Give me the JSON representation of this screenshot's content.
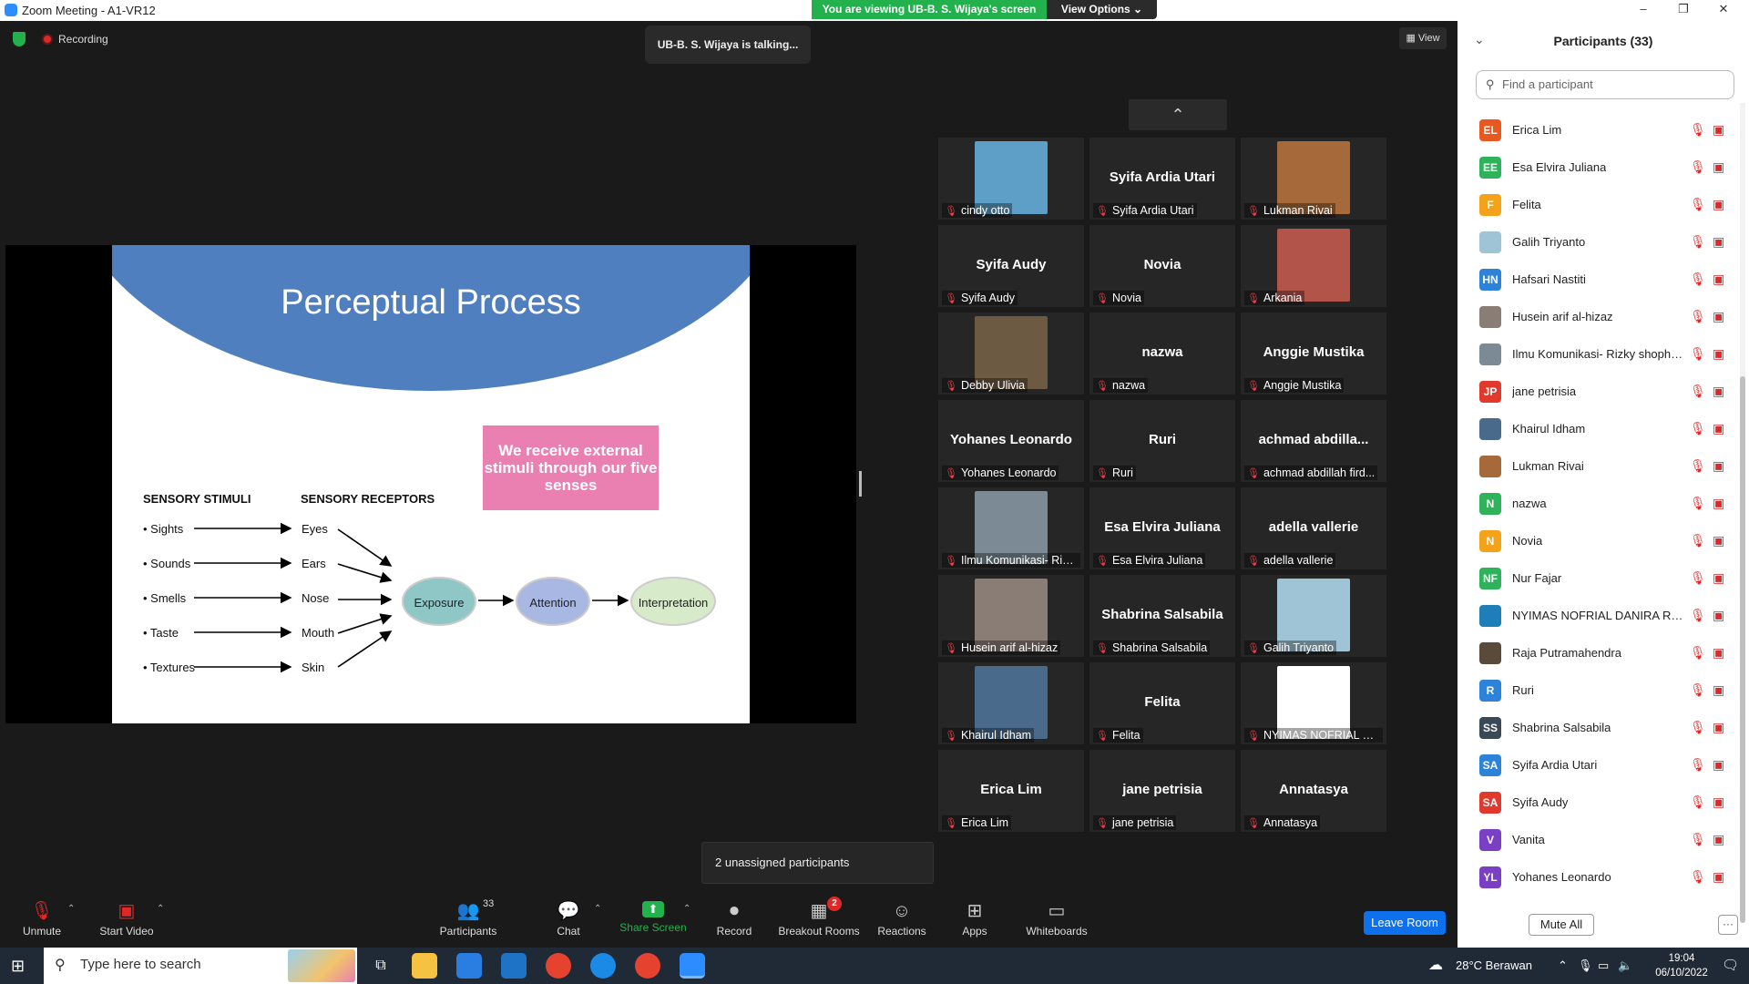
{
  "window": {
    "title": "Zoom Meeting - A1-VR12",
    "viewing_banner": "You are viewing UB-B. S. Wijaya's screen",
    "view_options_label": "View Options ⌄",
    "minimize": "–",
    "restore": "❐",
    "close": "✕"
  },
  "meeting": {
    "recording_label": "Recording",
    "talking_indicator": "UB-B. S. Wijaya is talking...",
    "view_button_label": "View",
    "unassigned_label": "2 unassigned participants"
  },
  "slide": {
    "title": "Perceptual Process",
    "callout": "We receive external stimuli through our five senses",
    "stimuli_header": "SENSORY STIMULI",
    "receptors_header": "SENSORY RECEPTORS",
    "stimuli": [
      "• Sights",
      "• Sounds",
      "• Smells",
      "• Taste",
      "• Textures"
    ],
    "receptors": [
      "Eyes",
      "Ears",
      "Nose",
      "Mouth",
      "Skin"
    ],
    "stages": [
      "Exposure",
      "Attention",
      "Interpretation"
    ]
  },
  "gallery": {
    "up_arrow": "⌃",
    "tiles": [
      {
        "label": "cindy otto",
        "big": "",
        "photo": "#5d9fc7"
      },
      {
        "label": "Syifa Ardia Utari",
        "big": "Syifa Ardia Utari",
        "photo": ""
      },
      {
        "label": "Lukman Rivai",
        "big": "",
        "photo": "#a66a3a"
      },
      {
        "label": "Syifa Audy",
        "big": "Syifa Audy",
        "photo": ""
      },
      {
        "label": "Novia",
        "big": "Novia",
        "photo": ""
      },
      {
        "label": "Arkania",
        "big": "",
        "photo": "#b2544a"
      },
      {
        "label": "Debby Ulivia",
        "big": "",
        "photo": "#6d5a43"
      },
      {
        "label": "nazwa",
        "big": "nazwa",
        "photo": ""
      },
      {
        "label": "Anggie Mustika",
        "big": "Anggie Mustika",
        "photo": ""
      },
      {
        "label": "Yohanes Leonardo",
        "big": "Yohanes Leonardo",
        "photo": ""
      },
      {
        "label": "Ruri",
        "big": "Ruri",
        "photo": ""
      },
      {
        "label": "achmad abdillah fird...",
        "big": "achmad  abdilla...",
        "photo": ""
      },
      {
        "label": "Ilmu Komunikasi- Rizk...",
        "big": "",
        "photo": "#7b8a95"
      },
      {
        "label": "Esa Elvira Juliana",
        "big": "Esa Elvira Juliana",
        "photo": ""
      },
      {
        "label": "adella vallerie",
        "big": "adella vallerie",
        "photo": ""
      },
      {
        "label": "Husein arif al-hizaz",
        "big": "",
        "photo": "#8a7d76"
      },
      {
        "label": "Shabrina Salsabila",
        "big": "Shabrina Salsabila",
        "photo": ""
      },
      {
        "label": "Galih Triyanto",
        "big": "",
        "photo": "#9fc4d6"
      },
      {
        "label": "Khairul Idham",
        "big": "",
        "photo": "#4a6a8c"
      },
      {
        "label": "Felita",
        "big": "Felita",
        "photo": ""
      },
      {
        "label": "NYIMAS NOFRIAL DA...",
        "big": "",
        "photo": "#ffffff"
      },
      {
        "label": "Erica Lim",
        "big": "Erica Lim",
        "photo": ""
      },
      {
        "label": "jane petrisia",
        "big": "jane petrisia",
        "photo": ""
      },
      {
        "label": "Annatasya",
        "big": "Annatasya",
        "photo": ""
      }
    ]
  },
  "toolbar": {
    "unmute": "Unmute",
    "start_video": "Start Video",
    "participants": "Participants",
    "participants_count": "33",
    "chat": "Chat",
    "share_screen": "Share Screen",
    "record": "Record",
    "breakout_rooms": "Breakout Rooms",
    "breakout_badge": "2",
    "reactions": "Reactions",
    "apps": "Apps",
    "whiteboards": "Whiteboards",
    "leave_room": "Leave Room"
  },
  "panel": {
    "title": "Participants (33)",
    "search_placeholder": "Find a participant",
    "mute_all": "Mute All",
    "more": "···",
    "participants": [
      {
        "initials": "EL",
        "name": "Erica Lim",
        "color": "#e8581f"
      },
      {
        "initials": "EE",
        "name": "Esa Elvira Juliana",
        "color": "#2fb35a"
      },
      {
        "initials": "F",
        "name": "Felita",
        "color": "#f5a21b"
      },
      {
        "initials": "",
        "name": "Galih Triyanto",
        "color": "#9fc4d6"
      },
      {
        "initials": "HN",
        "name": "Hafsari Nastiti",
        "color": "#2d82d9"
      },
      {
        "initials": "",
        "name": "Husein arif al-hizaz",
        "color": "#8a7d76"
      },
      {
        "initials": "",
        "name": "Ilmu Komunikasi- Rizky shophia...",
        "color": "#7b8a95"
      },
      {
        "initials": "JP",
        "name": "jane petrisia",
        "color": "#e03a2e"
      },
      {
        "initials": "",
        "name": "Khairul Idham",
        "color": "#4a6a8c"
      },
      {
        "initials": "",
        "name": "Lukman Rivai",
        "color": "#a66a3a"
      },
      {
        "initials": "N",
        "name": "nazwa",
        "color": "#2fb35a"
      },
      {
        "initials": "N",
        "name": "Novia",
        "color": "#f5a21b"
      },
      {
        "initials": "NF",
        "name": "Nur Fajar",
        "color": "#2fb35a"
      },
      {
        "initials": "",
        "name": "NYIMAS NOFRIAL DANIRA RIAN",
        "color": "#1e7fb8"
      },
      {
        "initials": "",
        "name": "Raja Putramahendra",
        "color": "#5a4a3a"
      },
      {
        "initials": "R",
        "name": "Ruri",
        "color": "#2d82d9"
      },
      {
        "initials": "SS",
        "name": "Shabrina Salsabila",
        "color": "#3b4856"
      },
      {
        "initials": "SA",
        "name": "Syifa Ardia Utari",
        "color": "#2d82d9"
      },
      {
        "initials": "SA",
        "name": "Syifa Audy",
        "color": "#e03a2e"
      },
      {
        "initials": "V",
        "name": "Vanita",
        "color": "#7a3fc4"
      },
      {
        "initials": "YL",
        "name": "Yohanes Leonardo",
        "color": "#7a3fc4"
      }
    ]
  },
  "taskbar": {
    "search_placeholder": "Type here to search",
    "weather": "28°C  Berawan",
    "time": "19:04",
    "date": "06/10/2022"
  }
}
